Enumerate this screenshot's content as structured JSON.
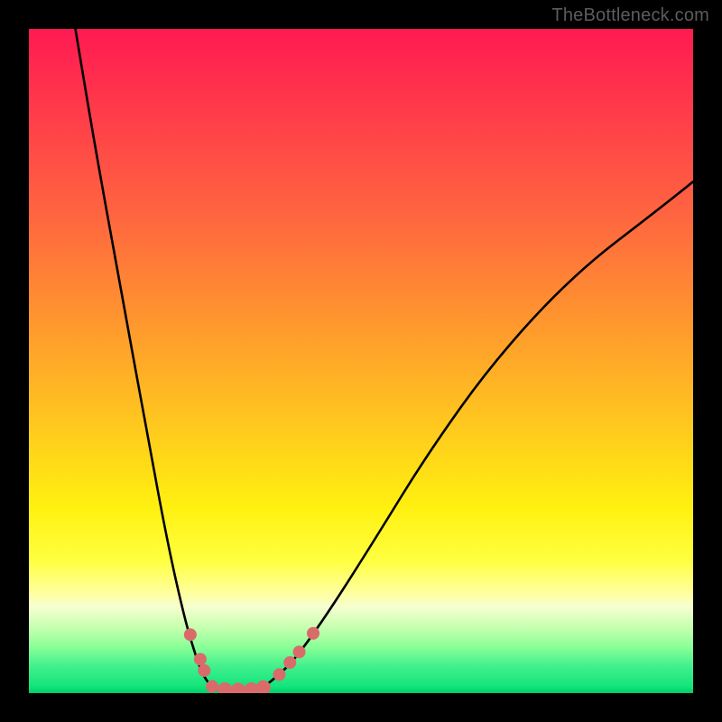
{
  "watermark": "TheBottleneck.com",
  "chart_data": {
    "type": "line",
    "title": "",
    "xlabel": "",
    "ylabel": "",
    "xlim": [
      0,
      100
    ],
    "ylim": [
      0,
      100
    ],
    "series": [
      {
        "name": "left-branch",
        "x": [
          7,
          10,
          14,
          18,
          21,
          23.5,
          25,
          26,
          27,
          28
        ],
        "y": [
          100,
          82,
          60,
          38,
          22,
          11,
          6,
          3.2,
          1.5,
          0.7
        ]
      },
      {
        "name": "right-branch",
        "x": [
          35,
          37,
          40,
          45,
          52,
          60,
          70,
          82,
          95,
          100
        ],
        "y": [
          0.7,
          2.2,
          5,
          12,
          23,
          36,
          50,
          63,
          73,
          77
        ]
      },
      {
        "name": "valley-flat",
        "x": [
          28,
          30,
          32,
          34,
          35
        ],
        "y": [
          0.7,
          0.55,
          0.5,
          0.55,
          0.7
        ]
      }
    ],
    "markers": [
      {
        "x": 24.3,
        "y": 8.8,
        "r": 7
      },
      {
        "x": 25.8,
        "y": 5.1,
        "r": 7
      },
      {
        "x": 26.4,
        "y": 3.4,
        "r": 7
      },
      {
        "x": 27.6,
        "y": 1.0,
        "r": 7
      },
      {
        "x": 29.5,
        "y": 0.55,
        "r": 8
      },
      {
        "x": 31.5,
        "y": 0.5,
        "r": 8
      },
      {
        "x": 33.5,
        "y": 0.55,
        "r": 8
      },
      {
        "x": 35.3,
        "y": 0.85,
        "r": 8
      },
      {
        "x": 37.7,
        "y": 2.8,
        "r": 7
      },
      {
        "x": 39.3,
        "y": 4.6,
        "r": 7
      },
      {
        "x": 40.7,
        "y": 6.2,
        "r": 7
      },
      {
        "x": 42.8,
        "y": 9.0,
        "r": 7
      }
    ],
    "marker_color": "#d96b6b",
    "curve_color": "#000000"
  }
}
